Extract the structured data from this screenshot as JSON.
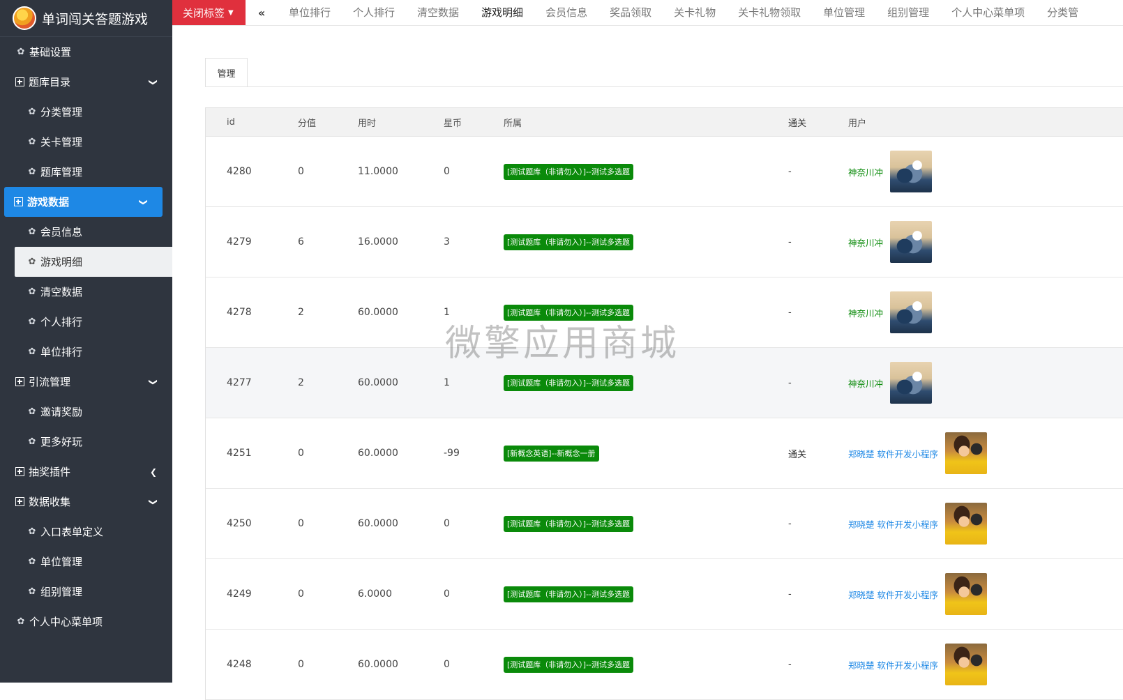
{
  "app": {
    "title": "单词闯关答题游戏"
  },
  "sidebar": {
    "items": [
      {
        "label": "基础设置",
        "level": 1,
        "icon": "gear-icon"
      },
      {
        "label": "题库目录",
        "level": 1,
        "icon": "plus-square-icon",
        "arrow": "chevron-down-icon"
      },
      {
        "label": "分类管理",
        "level": 2,
        "icon": "gear-icon"
      },
      {
        "label": "关卡管理",
        "level": 2,
        "icon": "gear-icon"
      },
      {
        "label": "题库管理",
        "level": 2,
        "icon": "gear-icon"
      },
      {
        "label": "游戏数据",
        "level": 1,
        "icon": "plus-square-icon",
        "arrow": "chevron-down-icon",
        "state": "active"
      },
      {
        "label": "会员信息",
        "level": 2,
        "icon": "gear-icon"
      },
      {
        "label": "游戏明细",
        "level": 2,
        "icon": "gear-icon",
        "state": "current"
      },
      {
        "label": "清空数据",
        "level": 2,
        "icon": "gear-icon"
      },
      {
        "label": "个人排行",
        "level": 2,
        "icon": "gear-icon"
      },
      {
        "label": "单位排行",
        "level": 2,
        "icon": "gear-icon"
      },
      {
        "label": "引流管理",
        "level": 1,
        "icon": "plus-square-icon",
        "arrow": "chevron-down-icon"
      },
      {
        "label": "邀请奖励",
        "level": 2,
        "icon": "gear-icon"
      },
      {
        "label": "更多好玩",
        "level": 2,
        "icon": "gear-icon"
      },
      {
        "label": "抽奖插件",
        "level": 1,
        "icon": "plus-square-icon",
        "arrow": "chevron-left-icon"
      },
      {
        "label": "数据收集",
        "level": 1,
        "icon": "plus-square-icon",
        "arrow": "chevron-down-icon"
      },
      {
        "label": "入口表单定义",
        "level": 2,
        "icon": "gear-icon"
      },
      {
        "label": "单位管理",
        "level": 2,
        "icon": "gear-icon"
      },
      {
        "label": "组别管理",
        "level": 2,
        "icon": "gear-icon"
      },
      {
        "label": "个人中心菜单项",
        "level": 1,
        "icon": "gear-icon"
      }
    ]
  },
  "topbar": {
    "close_label": "关闭标签",
    "back_glyph": "«",
    "tabs": [
      "单位排行",
      "个人排行",
      "清空数据",
      "游戏明细",
      "会员信息",
      "奖品领取",
      "关卡礼物",
      "关卡礼物领取",
      "单位管理",
      "组别管理",
      "个人中心菜单项",
      "分类管"
    ],
    "active_tab": "游戏明细"
  },
  "main": {
    "pane_tab": "管理",
    "columns": [
      "id",
      "分值",
      "用时",
      "星币",
      "所属",
      "通关",
      "用户"
    ],
    "rows": [
      {
        "id": "4280",
        "score": "0",
        "time": "11.0000",
        "coins": "0",
        "belong": "[测试题库（非请勿入）]--测试多选题",
        "pass": "-",
        "user": "神奈川冲",
        "user_color": "green",
        "avatar": "wave"
      },
      {
        "id": "4279",
        "score": "6",
        "time": "16.0000",
        "coins": "3",
        "belong": "[测试题库（非请勿入）]--测试多选题",
        "pass": "-",
        "user": "神奈川冲",
        "user_color": "green",
        "avatar": "wave"
      },
      {
        "id": "4278",
        "score": "2",
        "time": "60.0000",
        "coins": "1",
        "belong": "[测试题库（非请勿入）]--测试多选题",
        "pass": "-",
        "user": "神奈川冲",
        "user_color": "green",
        "avatar": "wave"
      },
      {
        "id": "4277",
        "score": "2",
        "time": "60.0000",
        "coins": "1",
        "belong": "[测试题库（非请勿入）]--测试多选题",
        "pass": "-",
        "user": "神奈川冲",
        "user_color": "green",
        "avatar": "wave",
        "hover": true
      },
      {
        "id": "4251",
        "score": "0",
        "time": "60.0000",
        "coins": "-99",
        "belong": "[新概念英语]--新概念一册",
        "pass": "通关",
        "user": "郑晓楚 软件开发小程序",
        "user_color": "blue",
        "avatar": "kid"
      },
      {
        "id": "4250",
        "score": "0",
        "time": "60.0000",
        "coins": "0",
        "belong": "[测试题库（非请勿入）]--测试多选题",
        "pass": "-",
        "user": "郑晓楚 软件开发小程序",
        "user_color": "blue",
        "avatar": "kid"
      },
      {
        "id": "4249",
        "score": "0",
        "time": "6.0000",
        "coins": "0",
        "belong": "[测试题库（非请勿入）]--测试多选题",
        "pass": "-",
        "user": "郑晓楚 软件开发小程序",
        "user_color": "blue",
        "avatar": "kid"
      },
      {
        "id": "4248",
        "score": "0",
        "time": "60.0000",
        "coins": "0",
        "belong": "[测试题库（非请勿入）]--测试多选题",
        "pass": "-",
        "user": "郑晓楚 软件开发小程序",
        "user_color": "blue",
        "avatar": "kid"
      }
    ]
  },
  "watermark": "微擎应用商城",
  "colors": {
    "sidebar_bg": "#2f353f",
    "active_blue": "#1e88e5",
    "close_red": "#e0303d",
    "badge_green": "#0a8a0a"
  }
}
